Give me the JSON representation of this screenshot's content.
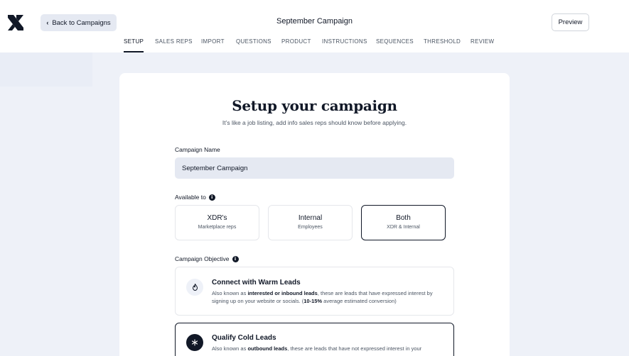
{
  "header": {
    "back_label": "Back to Campaigns",
    "title": "September Campaign",
    "preview_label": "Preview"
  },
  "tabs": [
    {
      "label": "SETUP",
      "active": true
    },
    {
      "label": "SALES REPS",
      "active": false
    },
    {
      "label": "IMPORT",
      "active": false
    },
    {
      "label": "QUESTIONS",
      "active": false
    },
    {
      "label": "PRODUCT",
      "active": false
    },
    {
      "label": "INSTRUCTIONS",
      "active": false
    },
    {
      "label": "SEQUENCES",
      "active": false
    },
    {
      "label": "THRESHOLD",
      "active": false
    },
    {
      "label": "REVIEW",
      "active": false
    }
  ],
  "main": {
    "heading": "Setup your campaign",
    "subheading": "It’s like a job listing, add info sales reps should know before applying.",
    "campaign_name_label": "Campaign Name",
    "campaign_name_value": "September Campaign",
    "available_label": "Available to",
    "available_options": [
      {
        "title": "XDR's",
        "subtitle": "Marketplace reps",
        "selected": false
      },
      {
        "title": "Internal",
        "subtitle": "Employees",
        "selected": false
      },
      {
        "title": "Both",
        "subtitle": "XDR & Internal",
        "selected": true
      }
    ],
    "objective_label": "Campaign Objective",
    "objectives": [
      {
        "title": "Connect with Warm Leads",
        "desc_1": "Also known as ",
        "desc_bold_1": "interested or inbound leads",
        "desc_2": ", these are leads that have expressed interest by signing up on your website or socials. (",
        "desc_bold_2": "10-15%",
        "desc_3": " average estimated conversion)",
        "icon": "flame-icon",
        "selected": false
      },
      {
        "title": "Qualify Cold Leads",
        "desc_1": "Also known as ",
        "desc_bold_1": "outbound leads",
        "desc_2": ", these are leads that have not expressed interest in your",
        "icon": "snowflake-icon",
        "selected": true
      }
    ]
  },
  "colors": {
    "accent": "#111827",
    "page_bg": "#eef1f8",
    "input_bg": "#e5e9f2"
  }
}
